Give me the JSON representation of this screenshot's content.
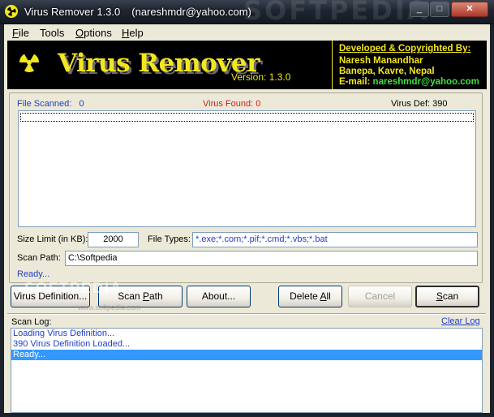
{
  "window": {
    "title": "Virus Remover 1.3.0",
    "title_email": "(nareshmdr@yahoo.com)",
    "watermark": "SOFTPEDIA",
    "minimize_glyph": "_",
    "maximize_glyph": "□",
    "close_glyph": "✕"
  },
  "menu": {
    "file_key": "F",
    "file_rest": "ile",
    "tools_key": "",
    "tools_rest": "Tools",
    "options_key": "O",
    "options_rest": "ptions",
    "help_key": "H",
    "help_rest": "elp"
  },
  "banner": {
    "app_name": "Virus Remover",
    "version": "Version: 1.3.0",
    "dev_heading": "Developed & Copyrighted By:",
    "dev_name": "Naresh Manandhar",
    "dev_location": "Banepa, Kavre, Nepal",
    "dev_email_label": "E-mail: ",
    "dev_email": "nareshmdr@yahoo.com",
    "colors": {
      "background": "#000000",
      "title": "#f3e620",
      "email": "#3fe03f"
    },
    "icon": "radiation-icon"
  },
  "stats": {
    "files_scanned_label": "File Scanned:",
    "files_scanned_value": "0",
    "virus_found_label": "Virus Found:",
    "virus_found_value": "0",
    "virus_def_label": "Virus Def:",
    "virus_def_value": "390"
  },
  "form": {
    "size_limit_label": "Size Limit (in KB):",
    "size_limit_value": "2000",
    "file_types_label": "File Types:",
    "file_types_value": "*.exe;*.com;*.pif;*.cmd;*.vbs;*.bat",
    "scan_path_label": "Scan Path:",
    "scan_path_value": "C:\\Softpedia",
    "status": "Ready..."
  },
  "buttons": {
    "virus_definition": "Virus Definition...",
    "scan_path_pre": "Scan ",
    "scan_path_key": "P",
    "scan_path_post": "ath",
    "about": "About...",
    "delete_all_pre": "Delete ",
    "delete_all_key": "A",
    "delete_all_post": "ll",
    "cancel": "Cancel",
    "scan_key": "S",
    "scan_post": "can"
  },
  "watermark": {
    "text": "SOFTPEDIA",
    "url": "www.softpedia.com"
  },
  "log": {
    "label": "Scan Log:",
    "clear_label": "Clear Log",
    "entries": [
      {
        "text": "Loading Virus Definition...",
        "selected": false
      },
      {
        "text": "390 Virus Definition Loaded...",
        "selected": false
      },
      {
        "text": "Ready...",
        "selected": true
      }
    ]
  }
}
